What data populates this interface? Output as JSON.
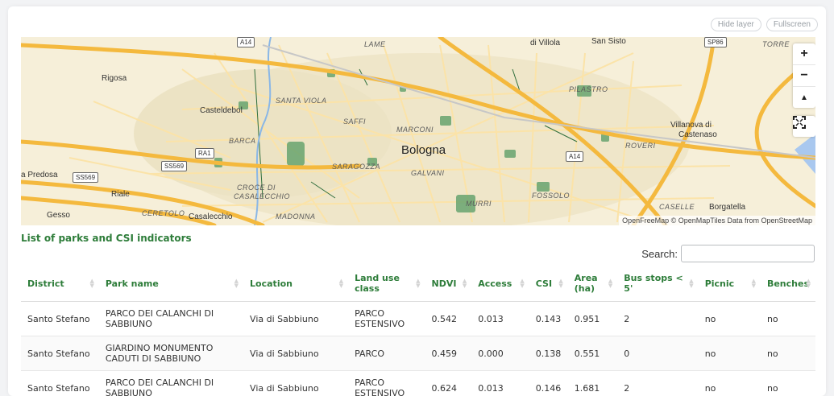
{
  "toolbar": {
    "hide_layer": "Hide layer",
    "fullscreen": "Fullscreen"
  },
  "map": {
    "places": {
      "bologna": "Bologna",
      "rigosa": "Rigosa",
      "casteldebole": "Casteldebol",
      "villanova": "Villanova di",
      "castenaso": "Castenaso",
      "predosa": "a Predosa",
      "riale": "Riale",
      "gesso": "Gesso",
      "casalecchio": "Casalecchio",
      "borgatella": "Borgatella",
      "di_villola": "di Villola",
      "san_sisto": "San Sisto"
    },
    "districts": {
      "santa_viola": "SANTA VIOLA",
      "saffi": "SAFFI",
      "marconi": "MARCONI",
      "barca": "BARCA",
      "saragozza": "SARAGOZZA",
      "galvani": "GALVANI",
      "croce_di": "CROCE DI",
      "casalecchio_d": "CASALECCHIO",
      "madonna": "MADONNA",
      "ceretolo": "CERETOLO",
      "murri": "MURRI",
      "fossolo": "FOSSOLO",
      "roveri": "ROVERI",
      "caselle": "CASELLE",
      "pilastro": "PILASTRO",
      "lame": "LAME",
      "torre": "TORRE"
    },
    "roads": {
      "a14_top": "A14",
      "a14_right": "A14",
      "ra1": "RA1",
      "ss569_a": "SS569",
      "ss569_b": "SS569",
      "sp86": "SP86"
    },
    "controls": {
      "zoom_in": "+",
      "zoom_out": "−",
      "compass": "▲"
    },
    "attribution": "OpenFreeMap © OpenMapTiles Data from OpenStreetMap",
    "colors": {
      "land": "#f6efd9",
      "park": "#3a8a4e",
      "road": "#f7c35c",
      "water": "#7fb0e0",
      "urban": "#ece6d0"
    }
  },
  "section_title": "List of parks and CSI indicators",
  "search": {
    "label": "Search:",
    "value": ""
  },
  "table": {
    "headers": [
      "District",
      "Park name",
      "Location",
      "Land use class",
      "NDVI",
      "Access",
      "CSI",
      "Area (ha)",
      "Bus stops < 5'",
      "Picnic",
      "Benches"
    ],
    "rows": [
      [
        "Santo Stefano",
        "PARCO DEI CALANCHI DI SABBIUNO",
        "Via di Sabbiuno",
        "PARCO ESTENSIVO",
        "0.542",
        "0.013",
        "0.143",
        "0.951",
        "2",
        "no",
        "no"
      ],
      [
        "Santo Stefano",
        "GIARDINO MONUMENTO CADUTI DI SABBIUNO",
        "Via di Sabbiuno",
        "PARCO",
        "0.459",
        "0.000",
        "0.138",
        "0.551",
        "0",
        "no",
        "no"
      ],
      [
        "Santo Stefano",
        "PARCO DEI CALANCHI DI SABBIUNO",
        "Via di Sabbiuno",
        "PARCO ESTENSIVO",
        "0.624",
        "0.013",
        "0.146",
        "1.681",
        "2",
        "no",
        "no"
      ]
    ]
  }
}
